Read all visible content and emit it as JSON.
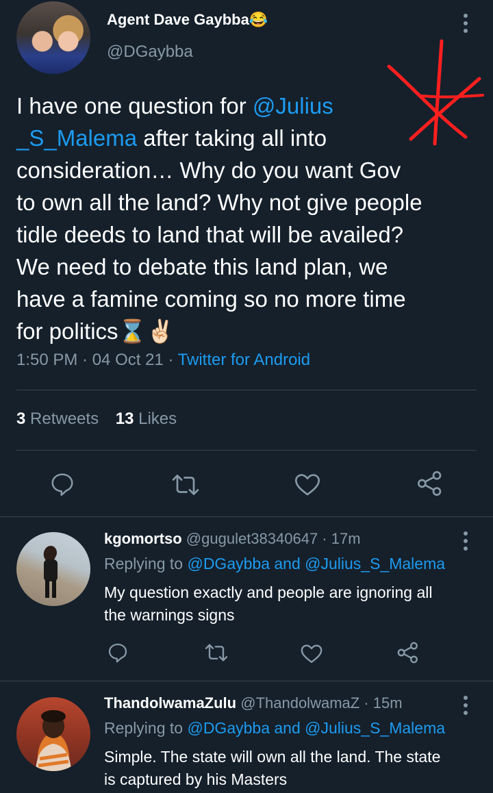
{
  "main_tweet": {
    "author_name": "Agent Dave Gaybba😂",
    "handle": "@DGaybba",
    "text_line1_a": "I have one question for ",
    "text_line1_mention": "@Julius",
    "text_line2_mention": "_S_Malema",
    "text_line2_b": " after taking all into",
    "text_line3": "consideration… Why do you want Gov",
    "text_line4": "to own all the land? Why not give people",
    "text_line5": "tidle deeds to land that will be availed?",
    "text_line6": "We need to debate this land plan, we",
    "text_line7": "have a famine coming so no more time",
    "text_line8": "for politics⌛✌🏻",
    "time": "1:50 PM · 04 Oct 21 · ",
    "source": "Twitter for Android",
    "retweets_count": "3",
    "retweets_label": " Retweets",
    "likes_count": "13",
    "likes_label": " Likes"
  },
  "replies": [
    {
      "name": "kgomortso",
      "meta": " @gugulet38340647 · 17m",
      "replying_label": "Replying to ",
      "replying_to": "@DGaybba and @Julius_S_Malema",
      "text_line1": "My question exactly and people are ignoring all",
      "text_line2": "the warnings signs"
    },
    {
      "name": "ThandolwamaZulu",
      "meta": " @ThandolwamaZ · 15m",
      "replying_label": "Replying to ",
      "replying_to": "@DGaybba and @Julius_S_Malema",
      "text_line1": "Simple. The state will own all the land. The state",
      "text_line2": "is captured by his Masters"
    }
  ],
  "icons": [
    "reply-icon",
    "retweet-icon",
    "like-icon",
    "share-icon",
    "more-icon"
  ],
  "colors": {
    "background": "#15202b",
    "accent": "#1d9bf0",
    "muted": "#8899a6",
    "divider": "#38444d",
    "annotation": "#ff1f1f"
  }
}
